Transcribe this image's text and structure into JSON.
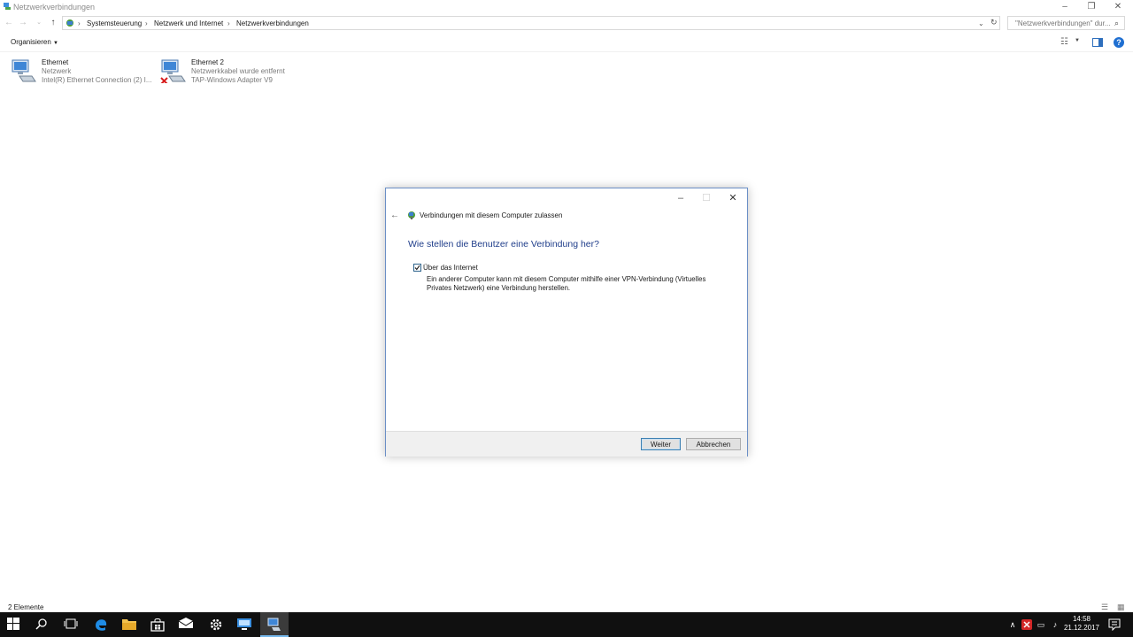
{
  "window": {
    "title": "Netzwerkverbindungen",
    "minimize": "–",
    "maximize": "❐",
    "close": "✕"
  },
  "address": {
    "crumbs": [
      "Systemsteuerung",
      "Netzwerk und Internet",
      "Netzwerkverbindungen"
    ],
    "search_placeholder": "\"Netzwerkverbindungen\" dur..."
  },
  "commandbar": {
    "organize_label": "Organisieren"
  },
  "items": [
    {
      "name": "Ethernet",
      "status": "Netzwerk",
      "adapter": "Intel(R) Ethernet Connection (2) I..."
    },
    {
      "name": "Ethernet 2",
      "status": "Netzwerkkabel wurde entfernt",
      "adapter": "TAP-Windows Adapter V9"
    }
  ],
  "dialog": {
    "title": "Verbindungen mit diesem Computer zulassen",
    "heading": "Wie stellen die Benutzer eine Verbindung her?",
    "checkbox_label": "Über das Internet",
    "checkbox_checked": true,
    "description": "Ein anderer Computer kann mit diesem Computer mithilfe einer VPN-Verbindung (Virtuelles Privates Netzwerk) eine Verbindung herstellen.",
    "next_label": "Weiter",
    "cancel_label": "Abbrechen"
  },
  "statusbar": {
    "text": "2 Elemente"
  },
  "taskbar": {
    "time": "14:58",
    "date": "21.12.2017"
  }
}
